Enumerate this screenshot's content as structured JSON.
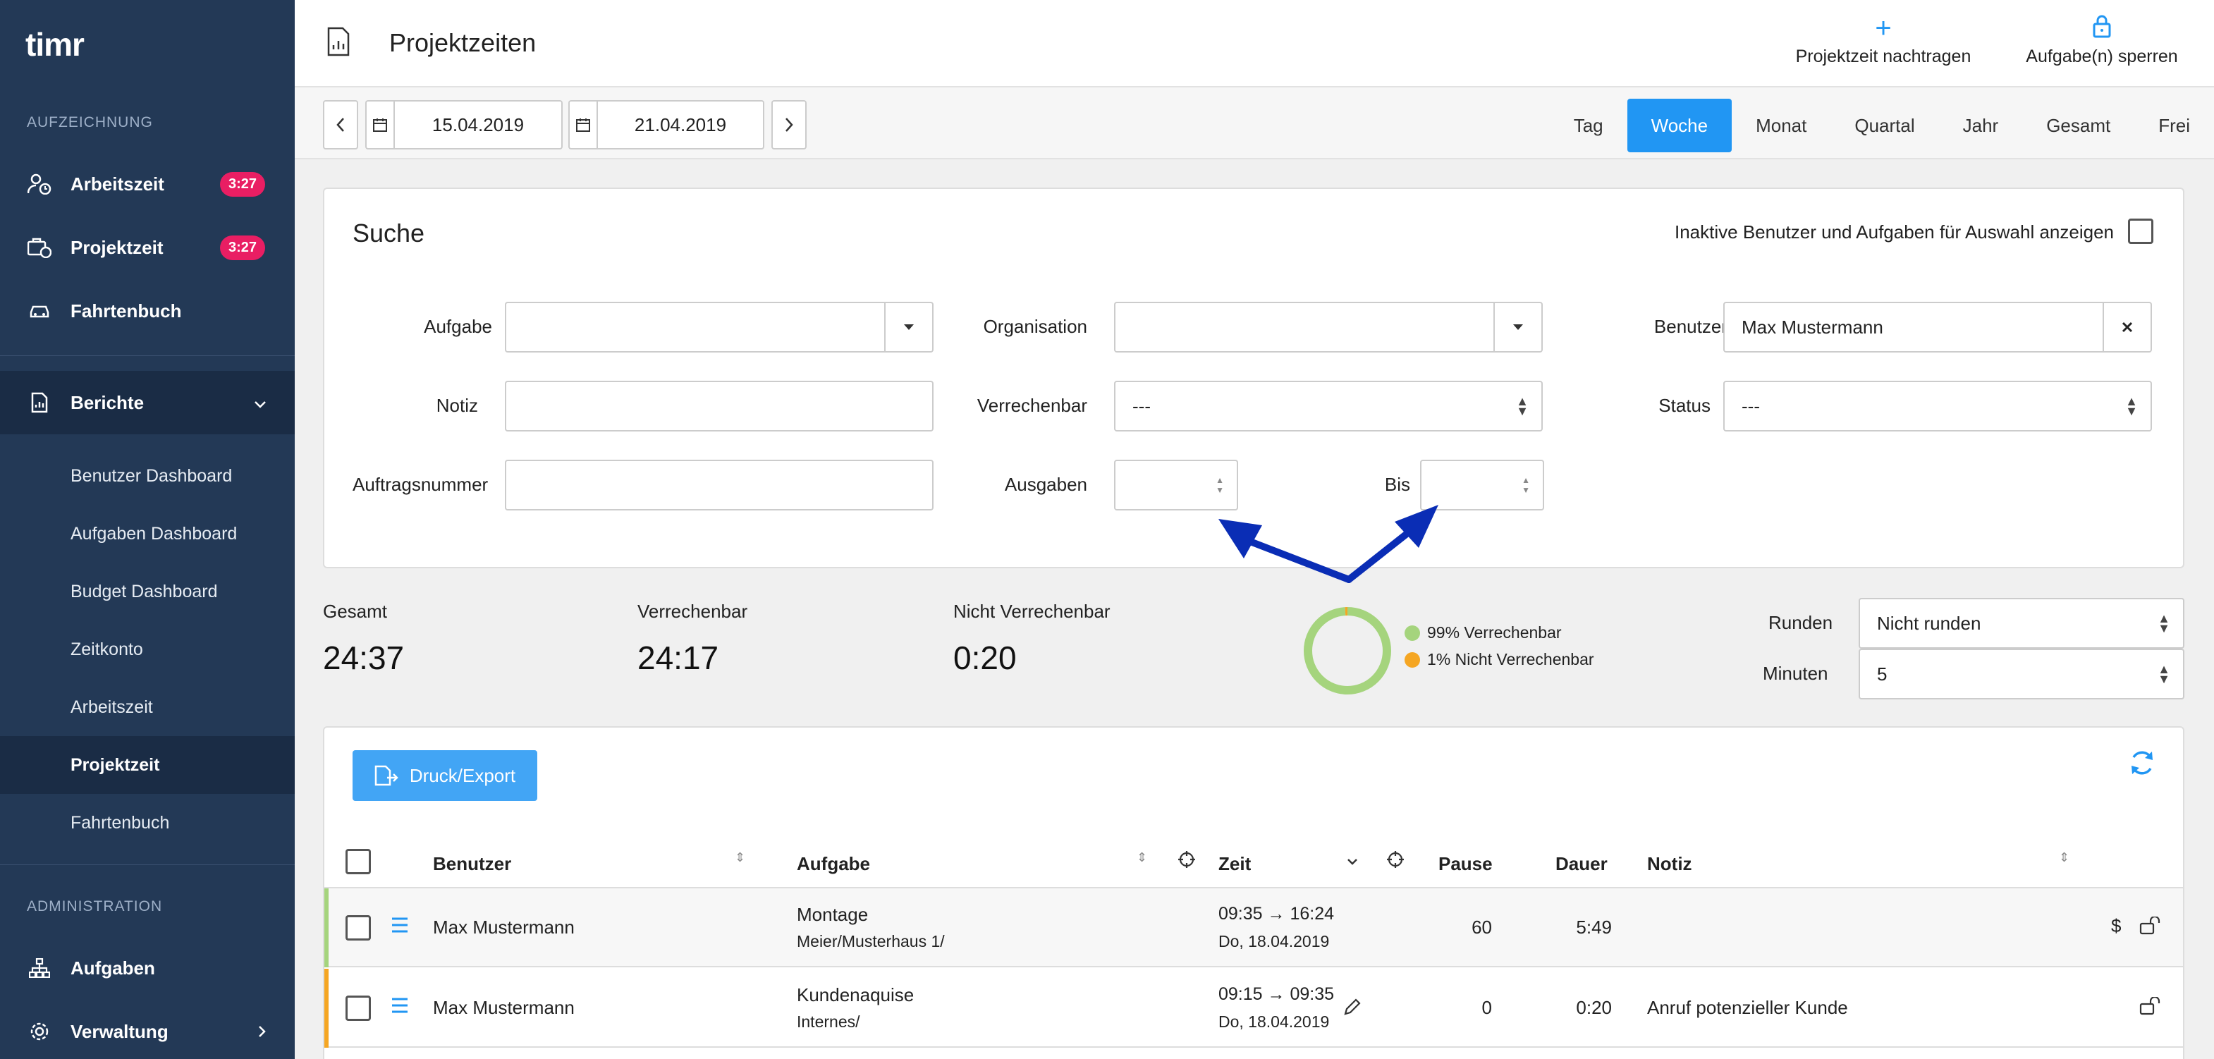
{
  "sidebar": {
    "logo": "timr",
    "section_recording": "AUFZEICHNUNG",
    "nav": [
      {
        "label": "Arbeitszeit",
        "badge": "3:27",
        "icon": "user-clock-icon"
      },
      {
        "label": "Projektzeit",
        "badge": "3:27",
        "icon": "briefcase-clock-icon"
      },
      {
        "label": "Fahrtenbuch",
        "icon": "car-icon"
      }
    ],
    "reports": {
      "label": "Berichte",
      "icon": "report-icon"
    },
    "sub_items": [
      "Benutzer Dashboard",
      "Aufgaben Dashboard",
      "Budget Dashboard",
      "Zeitkonto",
      "Arbeitszeit",
      "Projektzeit",
      "Fahrtenbuch"
    ],
    "section_admin": "ADMINISTRATION",
    "admin_nav": [
      {
        "label": "Aufgaben",
        "icon": "hierarchy-icon"
      },
      {
        "label": "Verwaltung",
        "icon": "gear-icon"
      }
    ]
  },
  "header": {
    "title": "Projektzeiten",
    "add_time": "Projektzeit nachtragen",
    "lock_tasks": "Aufgabe(n) sperren"
  },
  "datebar": {
    "from": "15.04.2019",
    "to": "21.04.2019",
    "tabs": [
      "Tag",
      "Woche",
      "Monat",
      "Quartal",
      "Jahr",
      "Gesamt",
      "Frei"
    ],
    "active_tab": "Woche"
  },
  "search": {
    "title": "Suche",
    "inactive_label": "Inaktive Benutzer und Aufgaben für Auswahl anzeigen",
    "labels": {
      "task": "Aufgabe",
      "org": "Organisation",
      "user": "Benutzer",
      "note": "Notiz",
      "billable": "Verrechenbar",
      "status": "Status",
      "order_no": "Auftragsnummer",
      "expenses": "Ausgaben",
      "to": "Bis"
    },
    "values": {
      "user": "Max Mustermann",
      "billable": "---",
      "status": "---"
    }
  },
  "summary": {
    "total_label": "Gesamt",
    "total": "24:37",
    "billable_label": "Verrechenbar",
    "billable": "24:17",
    "nonbillable_label": "Nicht Verrechenbar",
    "nonbillable": "0:20",
    "legend_billable": "99% Verrechenbar",
    "legend_nonbillable": "1% Nicht Verrechenbar",
    "billable_fraction": 0.99,
    "color_billable": "#a5d47d",
    "color_nonbillable": "#f5a623",
    "round_label": "Runden",
    "round_value": "Nicht runden",
    "minutes_label": "Minuten",
    "minutes_value": "5"
  },
  "table": {
    "export_label": "Druck/Export",
    "columns": {
      "user": "Benutzer",
      "task": "Aufgabe",
      "time": "Zeit",
      "pause": "Pause",
      "duration": "Dauer",
      "note": "Notiz"
    },
    "rows": [
      {
        "user": "Max Mustermann",
        "task": "Montage",
        "path": "Meier/Musterhaus 1/",
        "time": "09:35 → 16:24",
        "date": "Do, 18.04.2019",
        "pause": "60",
        "duration": "5:49",
        "note": "",
        "color": "#a5d47d"
      },
      {
        "user": "Max Mustermann",
        "task": "Kundenaquise",
        "path": "Internes/",
        "time": "09:15 → 09:35",
        "date": "Do, 18.04.2019",
        "pause": "0",
        "duration": "0:20",
        "note": "Anruf potenzieller Kunde",
        "color": "#f5a623"
      }
    ]
  }
}
